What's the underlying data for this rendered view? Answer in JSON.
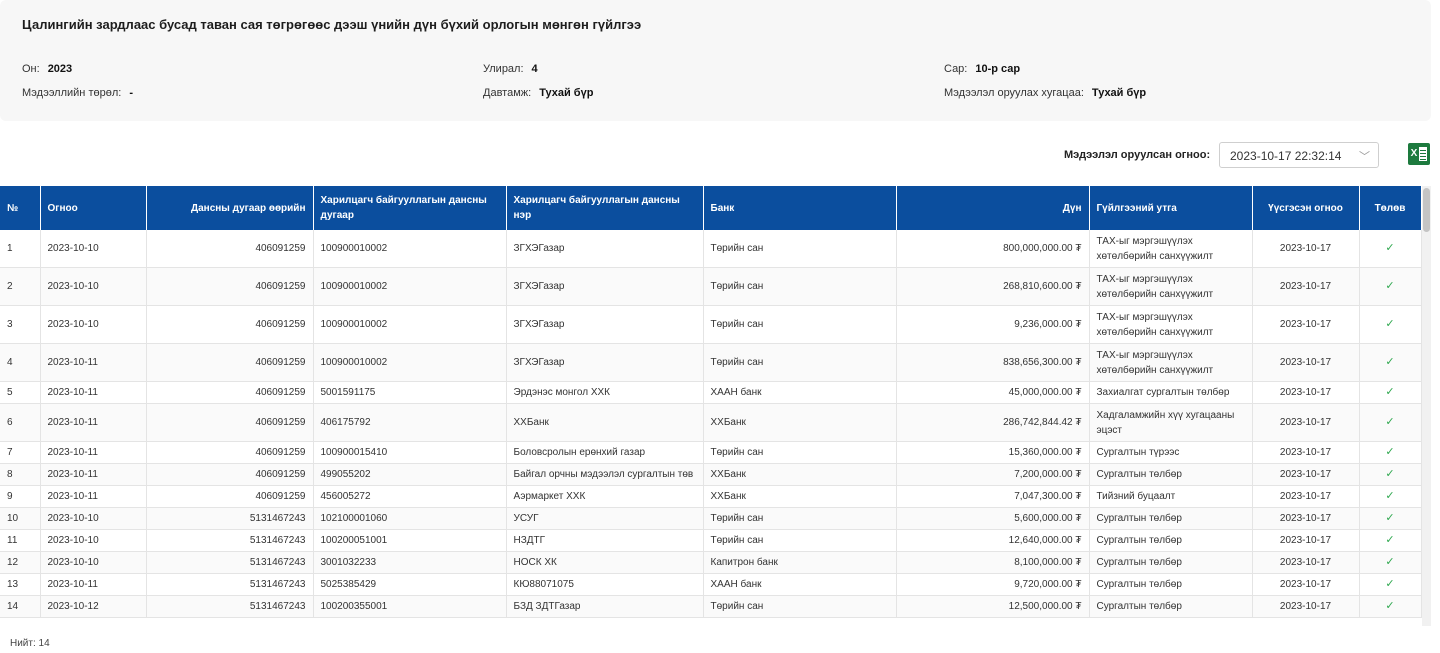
{
  "report": {
    "title": "Цалингийн зардлаас бусад таван сая төгрөгөөс дээш үнийн дүн бүхий орлогын мөнгөн гүйлгээ",
    "fields": {
      "year_label": "Он:",
      "year_value": "2023",
      "quarter_label": "Улирал:",
      "quarter_value": "4",
      "month_label": "Сар:",
      "month_value": "10-р сар",
      "info_type_label": "Мэдээллийн төрөл:",
      "info_type_value": "-",
      "frequency_label": "Давтамж:",
      "frequency_value": "Тухай бүр",
      "deadline_label": "Мэдээлэл оруулах хугацаа:",
      "deadline_value": "Тухай бүр"
    }
  },
  "filter": {
    "label": "Мэдээлэл оруулсан огноо:",
    "selected": "2023-10-17 22:32:14",
    "chevron": "chevron-down-icon"
  },
  "export": {
    "icon": "excel-icon",
    "mark": "X"
  },
  "table": {
    "headers": [
      "№",
      "Огноо",
      "Дансны дугаар өөрийн",
      "Харилцагч байгууллагын дансны дугаар",
      "Харилцагч байгууллагын дансны нэр",
      "Банк",
      "Дүн",
      "Гүйлгээний утга",
      "Үүсгэсэн огноо",
      "Төлөв"
    ],
    "rows": [
      {
        "no": "1",
        "date": "2023-10-10",
        "own": "406091259",
        "acct": "100900010002",
        "name": "ЗГХЭГазар",
        "bank": "Төрийн сан",
        "amount": "800,000,000.00 ₮",
        "purpose": "ТАХ-ыг мэргэшүүлэх хөтөлбөрийн санхүүжилт",
        "created": "2023-10-17",
        "status": "✓"
      },
      {
        "no": "2",
        "date": "2023-10-10",
        "own": "406091259",
        "acct": "100900010002",
        "name": "ЗГХЭГазар",
        "bank": "Төрийн сан",
        "amount": "268,810,600.00 ₮",
        "purpose": "ТАХ-ыг мэргэшүүлэх хөтөлбөрийн санхүүжилт",
        "created": "2023-10-17",
        "status": "✓"
      },
      {
        "no": "3",
        "date": "2023-10-10",
        "own": "406091259",
        "acct": "100900010002",
        "name": "ЗГХЭГазар",
        "bank": "Төрийн сан",
        "amount": "9,236,000.00 ₮",
        "purpose": "ТАХ-ыг мэргэшүүлэх хөтөлбөрийн санхүүжилт",
        "created": "2023-10-17",
        "status": "✓"
      },
      {
        "no": "4",
        "date": "2023-10-11",
        "own": "406091259",
        "acct": "100900010002",
        "name": "ЗГХЭГазар",
        "bank": "Төрийн сан",
        "amount": "838,656,300.00 ₮",
        "purpose": "ТАХ-ыг мэргэшүүлэх хөтөлбөрийн санхүүжилт",
        "created": "2023-10-17",
        "status": "✓"
      },
      {
        "no": "5",
        "date": "2023-10-11",
        "own": "406091259",
        "acct": "5001591175",
        "name": "Эрдэнэс монгол ХХК",
        "bank": "ХААН банк",
        "amount": "45,000,000.00 ₮",
        "purpose": "Захиалгат сургалтын төлбөр",
        "created": "2023-10-17",
        "status": "✓"
      },
      {
        "no": "6",
        "date": "2023-10-11",
        "own": "406091259",
        "acct": "406175792",
        "name": "ХХБанк",
        "bank": "ХХБанк",
        "amount": "286,742,844.42 ₮",
        "purpose": "Хадгаламжийн хүү хугацааны эцэст",
        "created": "2023-10-17",
        "status": "✓"
      },
      {
        "no": "7",
        "date": "2023-10-11",
        "own": "406091259",
        "acct": "100900015410",
        "name": "Боловсролын ерөнхий газар",
        "bank": "Төрийн сан",
        "amount": "15,360,000.00 ₮",
        "purpose": "Сургалтын түрээс",
        "created": "2023-10-17",
        "status": "✓"
      },
      {
        "no": "8",
        "date": "2023-10-11",
        "own": "406091259",
        "acct": "499055202",
        "name": "Байгал орчны мэдээлэл сургалтын төв",
        "bank": "ХХБанк",
        "amount": "7,200,000.00 ₮",
        "purpose": "Сургалтын төлбөр",
        "created": "2023-10-17",
        "status": "✓"
      },
      {
        "no": "9",
        "date": "2023-10-11",
        "own": "406091259",
        "acct": "456005272",
        "name": "Аэрмаркет ХХК",
        "bank": "ХХБанк",
        "amount": "7,047,300.00 ₮",
        "purpose": "Тийзний буцаалт",
        "created": "2023-10-17",
        "status": "✓"
      },
      {
        "no": "10",
        "date": "2023-10-10",
        "own": "5131467243",
        "acct": "102100001060",
        "name": "УСУГ",
        "bank": "Төрийн сан",
        "amount": "5,600,000.00 ₮",
        "purpose": "Сургалтын төлбөр",
        "created": "2023-10-17",
        "status": "✓"
      },
      {
        "no": "11",
        "date": "2023-10-10",
        "own": "5131467243",
        "acct": "100200051001",
        "name": "НЗДТГ",
        "bank": "Төрийн сан",
        "amount": "12,640,000.00 ₮",
        "purpose": "Сургалтын төлбөр",
        "created": "2023-10-17",
        "status": "✓"
      },
      {
        "no": "12",
        "date": "2023-10-10",
        "own": "5131467243",
        "acct": "3001032233",
        "name": "НОСК ХК",
        "bank": "Капитрон банк",
        "amount": "8,100,000.00 ₮",
        "purpose": "Сургалтын төлбөр",
        "created": "2023-10-17",
        "status": "✓"
      },
      {
        "no": "13",
        "date": "2023-10-11",
        "own": "5131467243",
        "acct": "5025385429",
        "name": "КЮ88071075",
        "bank": "ХААН банк",
        "amount": "9,720,000.00 ₮",
        "purpose": "Сургалтын төлбөр",
        "created": "2023-10-17",
        "status": "✓"
      },
      {
        "no": "14",
        "date": "2023-10-12",
        "own": "5131467243",
        "acct": "100200355001",
        "name": "БЗД ЗДТГазар",
        "bank": "Төрийн сан",
        "amount": "12,500,000.00 ₮",
        "purpose": "Сургалтын төлбөр",
        "created": "2023-10-17",
        "status": "✓"
      }
    ]
  },
  "footer": {
    "total": "Нийт: 14"
  },
  "colors": {
    "header_bg": "#0b4e9e",
    "check": "#2fa84f",
    "excel": "#1d7a3e"
  }
}
